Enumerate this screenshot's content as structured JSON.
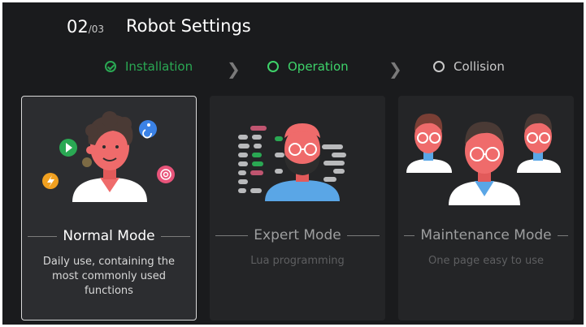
{
  "header": {
    "step_current": "02",
    "step_total": "/03",
    "title": "Robot Settings"
  },
  "steps": [
    {
      "label": "Installation",
      "state": "done",
      "color": "#2aa853"
    },
    {
      "label": "Operation",
      "state": "current",
      "color": "#3ed36a"
    },
    {
      "label": "Collision",
      "state": "pending",
      "color": "#c9c9c9"
    }
  ],
  "cards": [
    {
      "title": "Normal Mode",
      "description": "Daily use, containing the most commonly used functions",
      "selected": true
    },
    {
      "title": "Expert Mode",
      "description": "Lua programming",
      "selected": false
    },
    {
      "title": "Maintenance Mode",
      "description": "One page easy to use",
      "selected": false
    }
  ],
  "colors": {
    "background": "#1a1b1d",
    "card": "#242527",
    "accent_green": "#3ed36a",
    "skin": "#ef6b6b",
    "shirt": "#5aa6e6"
  }
}
